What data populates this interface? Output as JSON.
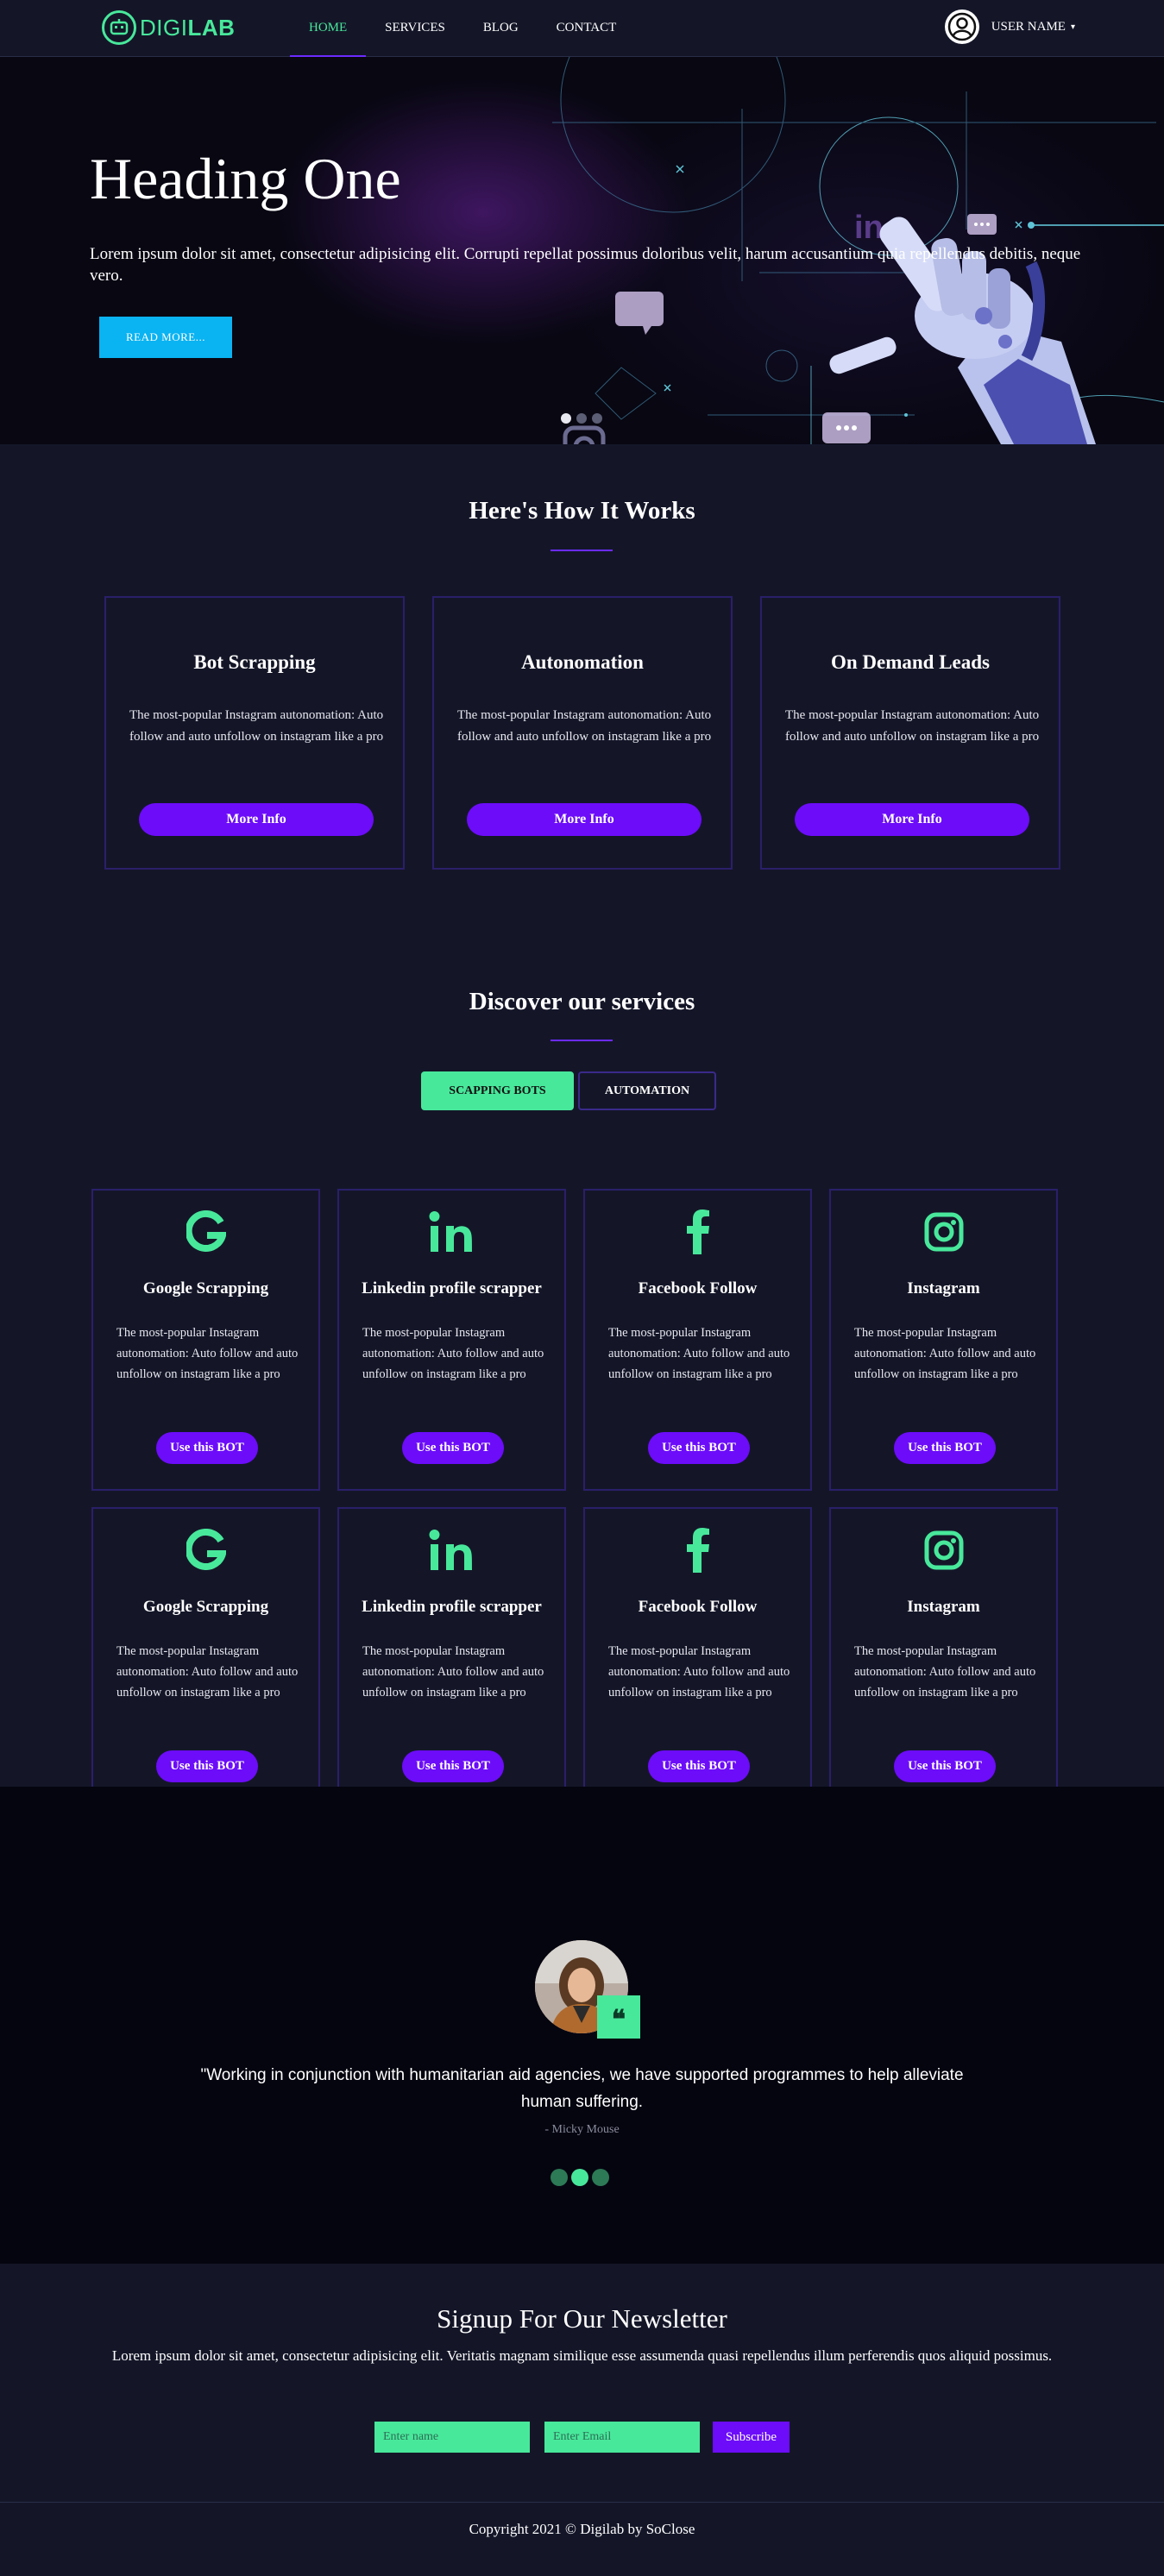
{
  "colors": {
    "background": "#141628",
    "accent_green": "#48e89b",
    "accent_purple": "#6c0cf9",
    "hero_button": "#0ab3f2",
    "testimonial_bg": "#050510"
  },
  "nav": {
    "logo": {
      "part1": "DIGI",
      "part2": "LAB",
      "icon": "robot-face-icon"
    },
    "items": [
      {
        "label": "HOME",
        "active": true
      },
      {
        "label": "SERVICES",
        "active": false
      },
      {
        "label": "BLOG",
        "active": false
      },
      {
        "label": "CONTACT",
        "active": false
      }
    ],
    "user": {
      "name": "USER NAME",
      "icon": "user-avatar-icon",
      "caret": "▾"
    }
  },
  "hero": {
    "title": "Heading One",
    "text": "Lorem ipsum dolor sit amet, consectetur adipisicing elit. Corrupti repellat possimus doloribus velit, harum accusantium quia repellendus debitis, neque vero.",
    "button": "READ MORE...",
    "slides": 3,
    "active_slide": 0
  },
  "how": {
    "title": "Here's How It Works",
    "cards": [
      {
        "title": "Bot Scrapping",
        "text": "The most-popular Instagram autonomation: Auto follow and auto unfollow on instagram like a pro",
        "button": "More Info"
      },
      {
        "title": "Autonomation",
        "text": "The most-popular Instagram autonomation: Auto follow and auto unfollow on instagram like a pro",
        "button": "More Info"
      },
      {
        "title": "On Demand Leads",
        "text": "The most-popular Instagram autonomation: Auto follow and auto unfollow on instagram like a pro",
        "button": "More Info"
      }
    ]
  },
  "services": {
    "title": "Discover our services",
    "tabs": [
      {
        "label": "SCAPPING BOTS",
        "active": true
      },
      {
        "label": "AUTOMATION",
        "active": false
      }
    ],
    "cards": [
      {
        "icon": "google-icon",
        "title": "Google Scrapping",
        "text": "The most-popular Instagram autonomation: Auto follow and auto unfollow on instagram like a pro",
        "button": "Use this BOT"
      },
      {
        "icon": "linkedin-icon",
        "title": "Linkedin profile scrapper",
        "text": "The most-popular Instagram autonomation: Auto follow and auto unfollow on instagram like a pro",
        "button": "Use this BOT"
      },
      {
        "icon": "facebook-icon",
        "title": "Facebook Follow",
        "text": "The most-popular Instagram autonomation: Auto follow and auto unfollow on instagram like a pro",
        "button": "Use this BOT"
      },
      {
        "icon": "instagram-icon",
        "title": "Instagram",
        "text": "The most-popular Instagram autonomation: Auto follow and auto unfollow on instagram like a pro",
        "button": "Use this BOT"
      },
      {
        "icon": "google-icon",
        "title": "Google Scrapping",
        "text": "The most-popular Instagram autonomation: Auto follow and auto unfollow on instagram like a pro",
        "button": "Use this BOT"
      },
      {
        "icon": "linkedin-icon",
        "title": "Linkedin profile scrapper",
        "text": "The most-popular Instagram autonomation: Auto follow and auto unfollow on instagram like a pro",
        "button": "Use this BOT"
      },
      {
        "icon": "facebook-icon",
        "title": "Facebook Follow",
        "text": "The most-popular Instagram autonomation: Auto follow and auto unfollow on instagram like a pro",
        "button": "Use this BOT"
      },
      {
        "icon": "instagram-icon",
        "title": "Instagram",
        "text": "The most-popular Instagram autonomation: Auto follow and auto unfollow on instagram like a pro",
        "button": "Use this BOT"
      }
    ]
  },
  "testimonial": {
    "quote_icon": "❝",
    "text": "\"Working in conjunction with humanitarian aid agencies, we have supported programmes to help alleviate human suffering.",
    "author": "- Micky Mouse",
    "slides": 3,
    "active_slide": 1
  },
  "newsletter": {
    "title": "Signup For Our Newsletter",
    "text": "Lorem ipsum dolor sit amet, consectetur adipisicing elit. Veritatis magnam similique esse assumenda quasi repellendus illum perferendis quos aliquid possimus.",
    "name_placeholder": "Enter name",
    "email_placeholder": "Enter Email",
    "button": "Subscribe"
  },
  "footer": {
    "copyright": "Copyright 2021 © Digilab by SoClose"
  }
}
